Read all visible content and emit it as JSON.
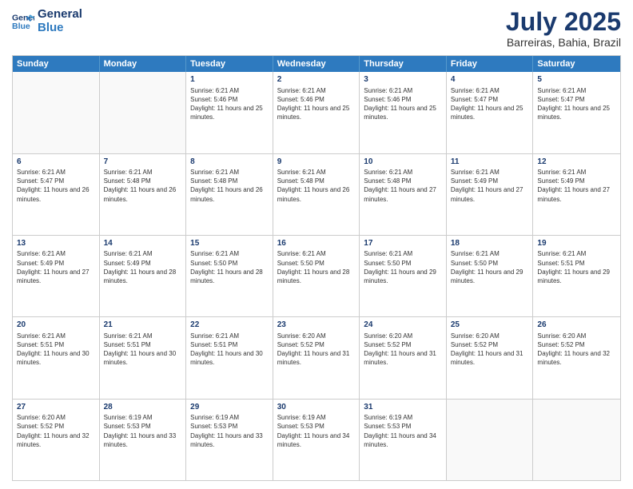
{
  "logo": {
    "line1": "General",
    "line2": "Blue"
  },
  "title": "July 2025",
  "subtitle": "Barreiras, Bahia, Brazil",
  "days": [
    "Sunday",
    "Monday",
    "Tuesday",
    "Wednesday",
    "Thursday",
    "Friday",
    "Saturday"
  ],
  "weeks": [
    [
      {
        "day": "",
        "info": ""
      },
      {
        "day": "",
        "info": ""
      },
      {
        "day": "1",
        "info": "Sunrise: 6:21 AM\nSunset: 5:46 PM\nDaylight: 11 hours and 25 minutes."
      },
      {
        "day": "2",
        "info": "Sunrise: 6:21 AM\nSunset: 5:46 PM\nDaylight: 11 hours and 25 minutes."
      },
      {
        "day": "3",
        "info": "Sunrise: 6:21 AM\nSunset: 5:46 PM\nDaylight: 11 hours and 25 minutes."
      },
      {
        "day": "4",
        "info": "Sunrise: 6:21 AM\nSunset: 5:47 PM\nDaylight: 11 hours and 25 minutes."
      },
      {
        "day": "5",
        "info": "Sunrise: 6:21 AM\nSunset: 5:47 PM\nDaylight: 11 hours and 25 minutes."
      }
    ],
    [
      {
        "day": "6",
        "info": "Sunrise: 6:21 AM\nSunset: 5:47 PM\nDaylight: 11 hours and 26 minutes."
      },
      {
        "day": "7",
        "info": "Sunrise: 6:21 AM\nSunset: 5:48 PM\nDaylight: 11 hours and 26 minutes."
      },
      {
        "day": "8",
        "info": "Sunrise: 6:21 AM\nSunset: 5:48 PM\nDaylight: 11 hours and 26 minutes."
      },
      {
        "day": "9",
        "info": "Sunrise: 6:21 AM\nSunset: 5:48 PM\nDaylight: 11 hours and 26 minutes."
      },
      {
        "day": "10",
        "info": "Sunrise: 6:21 AM\nSunset: 5:48 PM\nDaylight: 11 hours and 27 minutes."
      },
      {
        "day": "11",
        "info": "Sunrise: 6:21 AM\nSunset: 5:49 PM\nDaylight: 11 hours and 27 minutes."
      },
      {
        "day": "12",
        "info": "Sunrise: 6:21 AM\nSunset: 5:49 PM\nDaylight: 11 hours and 27 minutes."
      }
    ],
    [
      {
        "day": "13",
        "info": "Sunrise: 6:21 AM\nSunset: 5:49 PM\nDaylight: 11 hours and 27 minutes."
      },
      {
        "day": "14",
        "info": "Sunrise: 6:21 AM\nSunset: 5:49 PM\nDaylight: 11 hours and 28 minutes."
      },
      {
        "day": "15",
        "info": "Sunrise: 6:21 AM\nSunset: 5:50 PM\nDaylight: 11 hours and 28 minutes."
      },
      {
        "day": "16",
        "info": "Sunrise: 6:21 AM\nSunset: 5:50 PM\nDaylight: 11 hours and 28 minutes."
      },
      {
        "day": "17",
        "info": "Sunrise: 6:21 AM\nSunset: 5:50 PM\nDaylight: 11 hours and 29 minutes."
      },
      {
        "day": "18",
        "info": "Sunrise: 6:21 AM\nSunset: 5:50 PM\nDaylight: 11 hours and 29 minutes."
      },
      {
        "day": "19",
        "info": "Sunrise: 6:21 AM\nSunset: 5:51 PM\nDaylight: 11 hours and 29 minutes."
      }
    ],
    [
      {
        "day": "20",
        "info": "Sunrise: 6:21 AM\nSunset: 5:51 PM\nDaylight: 11 hours and 30 minutes."
      },
      {
        "day": "21",
        "info": "Sunrise: 6:21 AM\nSunset: 5:51 PM\nDaylight: 11 hours and 30 minutes."
      },
      {
        "day": "22",
        "info": "Sunrise: 6:21 AM\nSunset: 5:51 PM\nDaylight: 11 hours and 30 minutes."
      },
      {
        "day": "23",
        "info": "Sunrise: 6:20 AM\nSunset: 5:52 PM\nDaylight: 11 hours and 31 minutes."
      },
      {
        "day": "24",
        "info": "Sunrise: 6:20 AM\nSunset: 5:52 PM\nDaylight: 11 hours and 31 minutes."
      },
      {
        "day": "25",
        "info": "Sunrise: 6:20 AM\nSunset: 5:52 PM\nDaylight: 11 hours and 31 minutes."
      },
      {
        "day": "26",
        "info": "Sunrise: 6:20 AM\nSunset: 5:52 PM\nDaylight: 11 hours and 32 minutes."
      }
    ],
    [
      {
        "day": "27",
        "info": "Sunrise: 6:20 AM\nSunset: 5:52 PM\nDaylight: 11 hours and 32 minutes."
      },
      {
        "day": "28",
        "info": "Sunrise: 6:19 AM\nSunset: 5:53 PM\nDaylight: 11 hours and 33 minutes."
      },
      {
        "day": "29",
        "info": "Sunrise: 6:19 AM\nSunset: 5:53 PM\nDaylight: 11 hours and 33 minutes."
      },
      {
        "day": "30",
        "info": "Sunrise: 6:19 AM\nSunset: 5:53 PM\nDaylight: 11 hours and 34 minutes."
      },
      {
        "day": "31",
        "info": "Sunrise: 6:19 AM\nSunset: 5:53 PM\nDaylight: 11 hours and 34 minutes."
      },
      {
        "day": "",
        "info": ""
      },
      {
        "day": "",
        "info": ""
      }
    ]
  ]
}
